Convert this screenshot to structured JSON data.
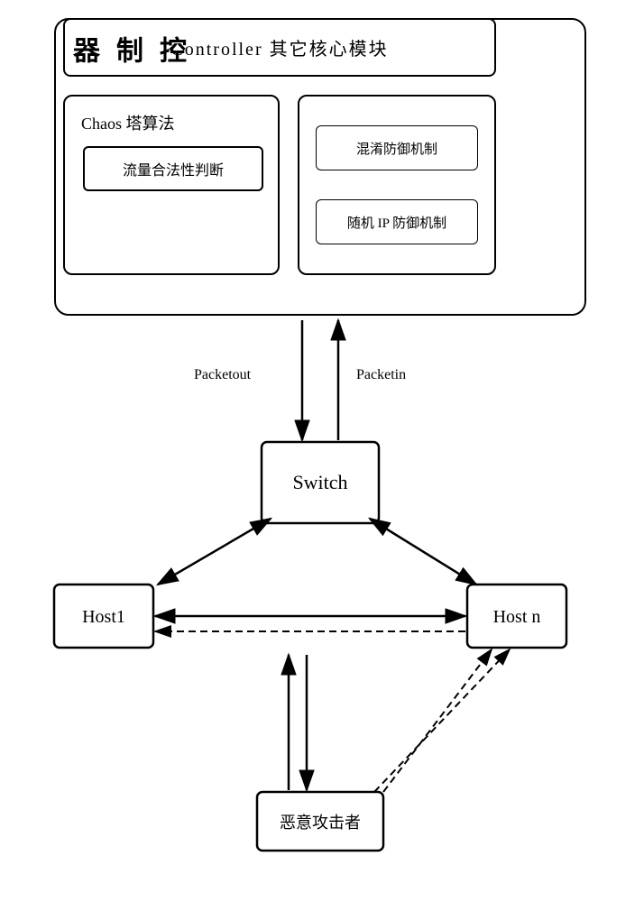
{
  "controller": {
    "label": "控\n制\n器",
    "label_chars": [
      "控",
      "制",
      "器"
    ],
    "inner_top_text": "Controller   其它核心模块",
    "chaos_label": "Chaos 塔算法",
    "traffic_label": "流量合法性判断",
    "defense1_label": "混淆防御机制",
    "defense2_label": "随机 IP 防御机制"
  },
  "network": {
    "switch_label": "Switch",
    "host1_label": "Host1",
    "hostn_label": "Host n",
    "attacker_label": "恶意攻击者",
    "packetout_label": "Packetout",
    "packetin_label": "Packetin"
  }
}
